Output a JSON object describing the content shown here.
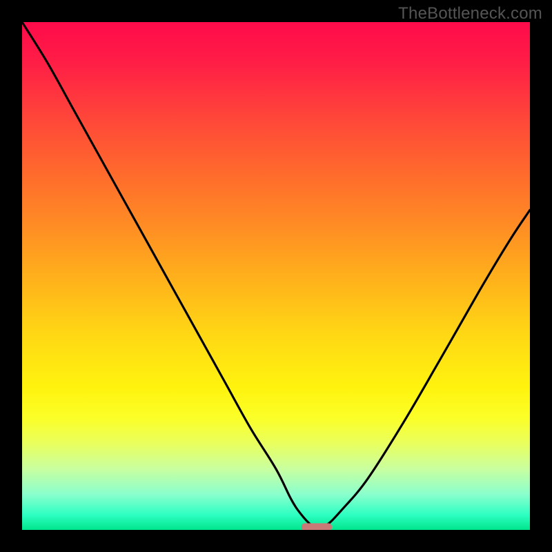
{
  "watermark": {
    "text": "TheBottleneck.com"
  },
  "colors": {
    "frame": "#000000",
    "curve_stroke": "#000000",
    "marker_fill": "#c97a76",
    "gradient_stops": [
      "#ff0a4a",
      "#ff1e46",
      "#ff4a38",
      "#ff6b2c",
      "#ff8c24",
      "#ffb61a",
      "#ffd914",
      "#fff30e",
      "#fbff28",
      "#e9ff5e",
      "#c9ffa0",
      "#8affcd",
      "#2effc2",
      "#00e58c"
    ]
  },
  "chart_data": {
    "type": "line",
    "title": "",
    "xlabel": "",
    "ylabel": "",
    "xlim": [
      0,
      100
    ],
    "ylim": [
      0,
      100
    ],
    "grid": false,
    "legend": false,
    "notes": "V-shaped bottleneck curve over vertical red→green gradient. Values are normalized to 0–100 in both axes. Minimum (0 bottleneck) near x≈58. Marker is a small rounded pink bar at the curve minimum.",
    "series": [
      {
        "name": "bottleneck-curve",
        "x": [
          0,
          5,
          10,
          15,
          20,
          25,
          30,
          35,
          40,
          45,
          50,
          53,
          55,
          57,
          58,
          60,
          63,
          68,
          75,
          82,
          90,
          96,
          100
        ],
        "y": [
          100,
          92,
          83,
          74,
          65,
          56,
          47,
          38,
          29,
          20,
          12,
          6,
          3,
          0.9,
          0.6,
          1,
          4,
          10,
          21,
          33,
          47,
          57,
          63
        ]
      }
    ],
    "marker": {
      "shape": "rounded-bar",
      "x_center": 58,
      "y_center": 0.6,
      "width": 6,
      "height": 1.4
    }
  }
}
